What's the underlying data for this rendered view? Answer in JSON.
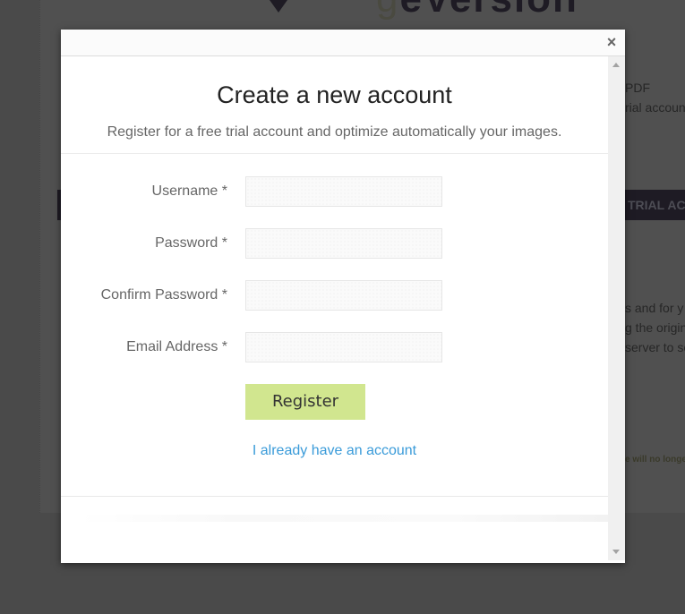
{
  "background": {
    "logo_text": "ageVersion",
    "right_fragments": [
      "PDF",
      "rial account"
    ],
    "banner_fragment": "TRIAL AC",
    "paragraph_fragments": [
      "s and for y",
      "g the origin",
      "server to se"
    ],
    "small_fragment": "e will no longer"
  },
  "modal": {
    "close_label": "×",
    "title": "Create a new account",
    "subtitle": "Register for a free trial account and optimize automatically your images.",
    "fields": [
      {
        "label": "Username *",
        "value": "",
        "placeholder": "",
        "type": "text"
      },
      {
        "label": "Password *",
        "value": "",
        "placeholder": "",
        "type": "password"
      },
      {
        "label": "Confirm Password *",
        "value": "",
        "placeholder": "",
        "type": "password"
      },
      {
        "label": "Email Address *",
        "value": "",
        "placeholder": "",
        "type": "email"
      }
    ],
    "register_label": "Register",
    "login_link": "I already have an account"
  },
  "colors": {
    "register_button": "#d1e68f",
    "link": "#3a9bd9",
    "overlay": "#4a4a4a"
  }
}
